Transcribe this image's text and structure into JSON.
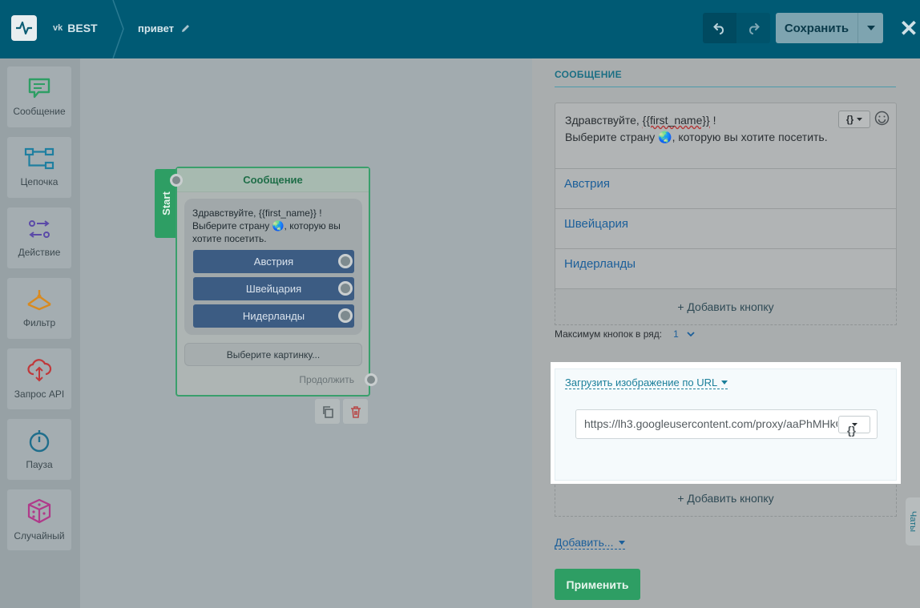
{
  "header": {
    "project_badge": "vk",
    "project_name": "BEST",
    "flow_name": "привет",
    "save_label": "Сохранить"
  },
  "sidebar": {
    "tools": [
      {
        "label": "Сообщение",
        "icon": "message-icon",
        "color": "#2e9e64"
      },
      {
        "label": "Цепочка",
        "icon": "chain-icon",
        "color": "#1f7fa0"
      },
      {
        "label": "Действие",
        "icon": "action-icon",
        "color": "#5b4aa8"
      },
      {
        "label": "Фильтр",
        "icon": "filter-icon",
        "color": "#d88a20"
      },
      {
        "label": "Запрос API",
        "icon": "cloud-api-icon",
        "color": "#c0393b"
      },
      {
        "label": "Пауза",
        "icon": "stopwatch-icon",
        "color": "#1f6e8c"
      },
      {
        "label": "Случайный",
        "icon": "dice-icon",
        "color": "#b03a8a"
      }
    ]
  },
  "canvas": {
    "start_label": "Start",
    "node": {
      "title": "Сообщение",
      "text_line1": "Здравствуйте,  {{first_name}} !",
      "text_line2": "Выберите страну 🌏, которую вы хотите посетить.",
      "buttons": [
        "Австрия",
        "Швейцария",
        "Нидерланды"
      ],
      "image_button": "Выберите картинку...",
      "continue_label": "Продолжить"
    }
  },
  "panel": {
    "title": "СООБЩЕНИЕ",
    "message_line1_pre": "Здравствуйте,  ",
    "message_var": "{{first_name}}",
    "message_line1_post": " !",
    "message_line2": "Выберите страну 🌏, которую вы хотите посетить.",
    "var_button": "{}",
    "options": [
      "Австрия",
      "Швейцария",
      "Нидерланды"
    ],
    "add_button": "+ Добавить кнопку",
    "max_buttons_label": "Максимум кнопок в ряд:",
    "max_buttons_value": "1",
    "upload_link": "Загрузить изображение по URL",
    "url_value": "https://lh3.googleusercontent.com/proxy/aaPhMHkQ",
    "add_button_2": "+ Добавить кнопку",
    "add_menu": "Добавить...",
    "apply_label": "Применить",
    "chats_label": "Чаты"
  }
}
